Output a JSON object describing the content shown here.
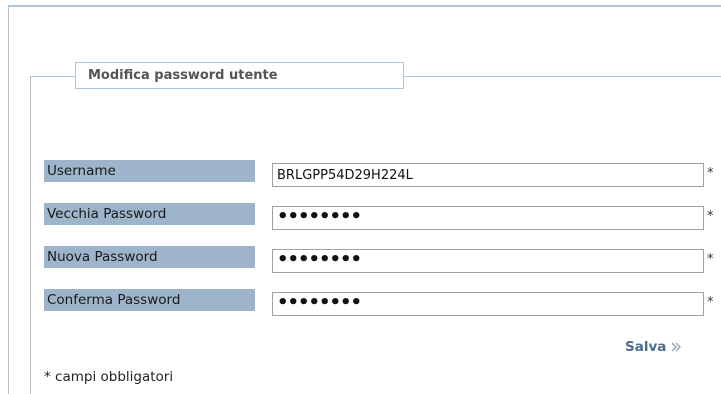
{
  "form": {
    "legend": "Modifica password utente",
    "fields": [
      {
        "label": "Username",
        "value": "BRLGPP54D29H224L",
        "type": "text",
        "required_mark": "*"
      },
      {
        "label": "Vecchia Password",
        "value": "••••••••",
        "type": "password",
        "required_mark": "*"
      },
      {
        "label": "Nuova Password",
        "value": "••••••••",
        "type": "password",
        "required_mark": "*"
      },
      {
        "label": "Conferma Password",
        "value": "••••••••",
        "type": "password",
        "required_mark": "*"
      }
    ],
    "save_label": "Salva",
    "save_icon": "double-chevron-right-icon",
    "footnote": "* campi obbligatori"
  },
  "colors": {
    "label_background": "#9db4cb",
    "border": "#aec6d8",
    "save_text": "#4b6e8e"
  }
}
